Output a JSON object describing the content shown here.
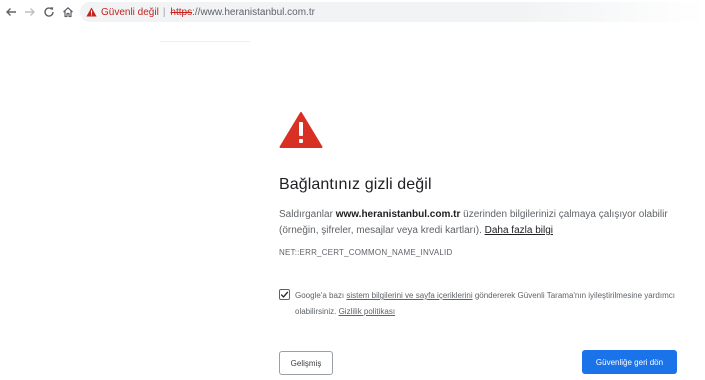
{
  "browser": {
    "security_label": "Güvenli değil",
    "separator": "|",
    "url_scheme": "https",
    "url_rest": "://www.heranistanbul.com.tr"
  },
  "interstitial": {
    "title": "Bağlantınız gizli değil",
    "desc_prefix": "Saldırganlar ",
    "desc_domain": "www.heranistanbul.com.tr",
    "desc_suffix": " üzerinden bilgilerinizi çalmaya çalışıyor olabilir (örneğin, şifreler, mesajlar veya kredi kartları). ",
    "learn_more": "Daha fazla bilgi",
    "error_code": "NET::ERR_CERT_COMMON_NAME_INVALID",
    "optin_prefix": "Google'a bazı ",
    "optin_link": "sistem bilgilerini ve sayfa içeriklerini",
    "optin_middle": " göndererek Güvenli Tarama'nın iyileştirilmesine yardımcı olabilirsiniz. ",
    "privacy_link": "Gizlilik politikası",
    "optin_checked": true,
    "advanced_button": "Gelişmiş",
    "back_button": "Güvenliğe geri dön"
  },
  "icons": {
    "back": "arrow-left-icon",
    "forward": "arrow-right-icon",
    "reload": "reload-icon",
    "home": "home-icon",
    "security": "warning-triangle-icon",
    "big_warning": "warning-triangle-icon",
    "check": "checkmark-icon"
  },
  "colors": {
    "danger": "#c5221f",
    "warning_icon": "#d93025",
    "primary_button": "#1a73e8"
  }
}
